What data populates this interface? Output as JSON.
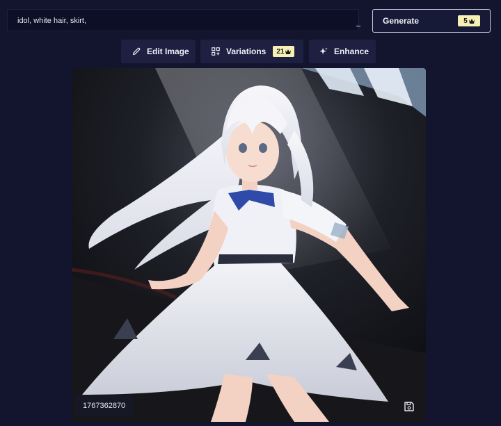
{
  "prompt": {
    "value": "idol, white hair, skirt,"
  },
  "generate": {
    "label": "Generate",
    "cost": "5"
  },
  "toolbar": {
    "edit_label": "Edit Image",
    "variations_label": "Variations",
    "variations_cost": "21",
    "enhance_label": "Enhance"
  },
  "image": {
    "seed": "1767362870",
    "description_icon": "generated-anime-image"
  },
  "icons": {
    "edit": "pencil-icon",
    "variations": "grid-plus-icon",
    "enhance": "sparkle-icon",
    "credit": "crown-icon",
    "save": "floppy-disk-icon"
  },
  "colors": {
    "background": "#13152e",
    "button": "#1d2040",
    "badge": "#f7f0b5"
  }
}
